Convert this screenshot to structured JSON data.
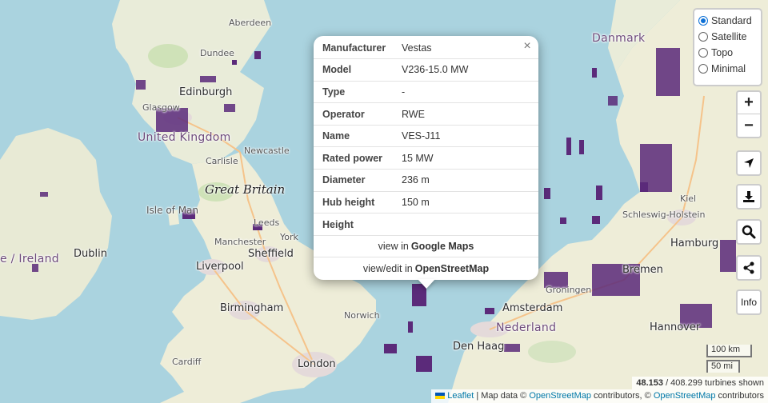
{
  "layers": {
    "options": [
      "Standard",
      "Satellite",
      "Topo",
      "Minimal"
    ],
    "selected": "Standard"
  },
  "controls": {
    "zoom_in": "+",
    "zoom_out": "−",
    "locate_icon": "navigation-arrow-icon",
    "download_icon": "download-icon",
    "search_icon": "search-icon",
    "share_icon": "share-icon",
    "info_label": "Info"
  },
  "popup": {
    "close": "×",
    "rows": [
      {
        "key": "Manufacturer",
        "value": "Vestas"
      },
      {
        "key": "Model",
        "value": "V236-15.0 MW"
      },
      {
        "key": "Type",
        "value": "-"
      },
      {
        "key": "Operator",
        "value": "RWE"
      },
      {
        "key": "Name",
        "value": "VES-J11"
      },
      {
        "key": "Rated power",
        "value": "15 MW"
      },
      {
        "key": "Diameter",
        "value": "236 m"
      },
      {
        "key": "Hub height",
        "value": "150 m"
      },
      {
        "key": "Height",
        "value": ""
      }
    ],
    "google_prefix": "view in",
    "google_link": "Google Maps",
    "osm_prefix": "view/edit in",
    "osm_link": "OpenStreetMap"
  },
  "map_labels": {
    "edinburgh": "Edinburgh",
    "glasgow": "Glasgow",
    "united_kingdom": "United Kingdom",
    "great_britain": "Great Britain",
    "isle_of_man": "Isle of Man",
    "ireland": "e / Ireland",
    "dublin": "Dublin",
    "liverpool": "Liverpool",
    "sheffield": "Sheffield",
    "birmingham": "Birmingham",
    "london": "London",
    "norwich": "Norwich",
    "cardiff": "Cardiff",
    "newcastle": "Newcastle",
    "leeds": "Leeds",
    "manchester": "Manchester",
    "carlisle": "Carlisle",
    "york": "York",
    "hamburg": "Hamburg",
    "bremen": "Bremen",
    "hannover": "Hannover",
    "den_haag": "Den Haag",
    "nederland": "Nederland",
    "amsterdam": "Amsterdam",
    "kiel": "Kiel",
    "schleswig": "Schleswig-Holstein",
    "danmark": "Danmark",
    "groningen": "Groningen",
    "aberdeen": "Aberdeen",
    "dundee": "Dundee"
  },
  "scale": {
    "km": "100 km",
    "mi": "50 mi"
  },
  "counter": {
    "shown": "48.153",
    "rest": " / 408.299 turbines shown"
  },
  "attribution": {
    "leaflet": "Leaflet",
    "sep1": " | Map data © ",
    "osm1": "OpenStreetMap",
    "contrib1": " contributors, © ",
    "osm2": "OpenStreetMap",
    "contrib2": " contributors"
  },
  "colors": {
    "water": "#aad3df",
    "land": "#f2efe9",
    "turbine": "#5b2a7a",
    "accent": "#0078a8"
  }
}
